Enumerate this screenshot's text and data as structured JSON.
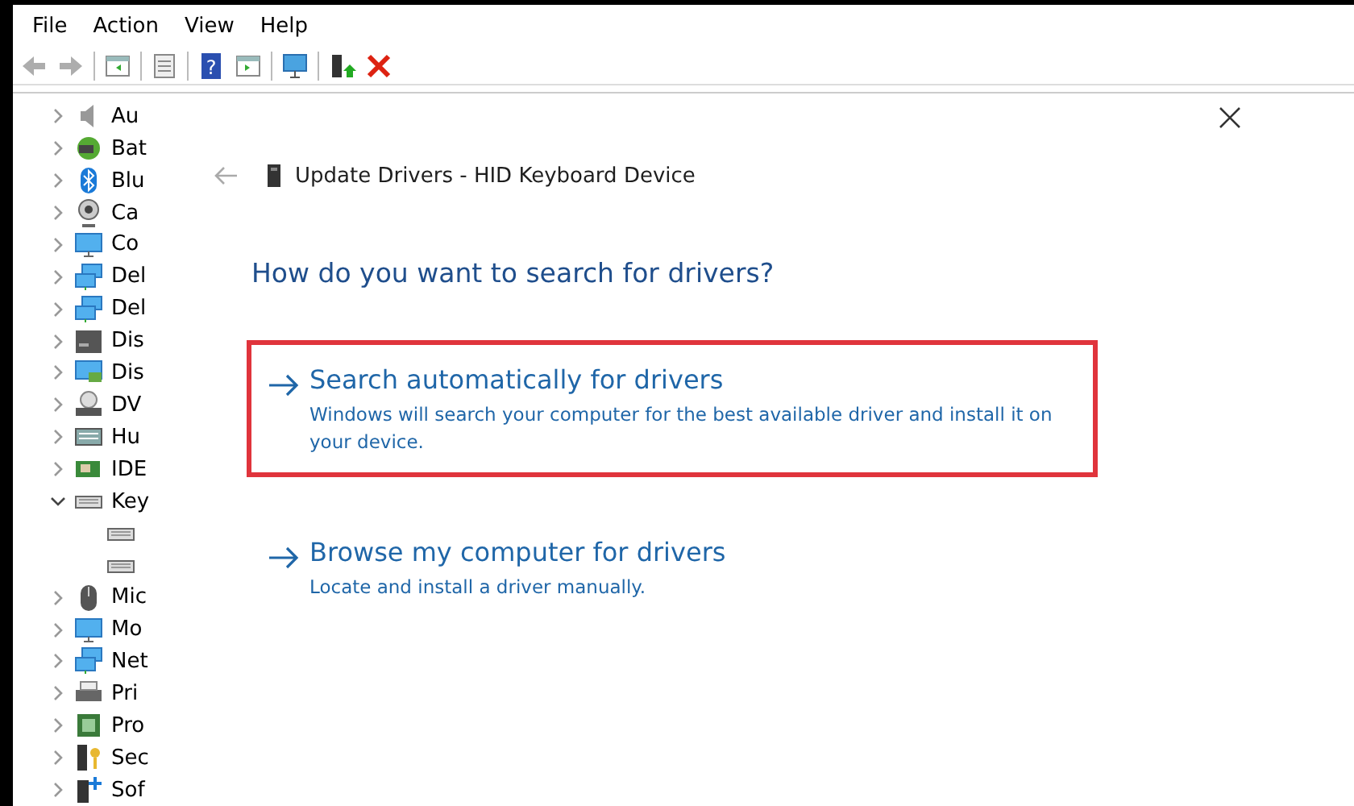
{
  "menu": [
    {
      "label": "File"
    },
    {
      "label": "Action"
    },
    {
      "label": "View"
    },
    {
      "label": "Help"
    }
  ],
  "toolbar": [
    {
      "kind": "back",
      "disabled": true
    },
    {
      "kind": "forward",
      "disabled": true
    },
    {
      "kind": "sep"
    },
    {
      "kind": "pane"
    },
    {
      "kind": "sep"
    },
    {
      "kind": "props"
    },
    {
      "kind": "sep"
    },
    {
      "kind": "help",
      "label": "?"
    },
    {
      "kind": "pane2"
    },
    {
      "kind": "sep"
    },
    {
      "kind": "scan"
    },
    {
      "kind": "sep"
    },
    {
      "kind": "update"
    },
    {
      "kind": "remove"
    }
  ],
  "tree": [
    {
      "label": "Au",
      "kind": "speaker",
      "expanded": false
    },
    {
      "label": "Bat",
      "kind": "battery",
      "expanded": false
    },
    {
      "label": "Blu",
      "kind": "bluetooth",
      "expanded": false
    },
    {
      "label": "Ca",
      "kind": "camera",
      "expanded": false
    },
    {
      "label": "Co",
      "kind": "monitor",
      "expanded": false
    },
    {
      "label": "Del",
      "kind": "network",
      "expanded": false
    },
    {
      "label": "Del",
      "kind": "network",
      "expanded": false
    },
    {
      "label": "Dis",
      "kind": "drive",
      "expanded": false
    },
    {
      "label": "Dis",
      "kind": "display",
      "expanded": false
    },
    {
      "label": "DV",
      "kind": "dvd",
      "expanded": false
    },
    {
      "label": "Hu",
      "kind": "hid",
      "expanded": false
    },
    {
      "label": "IDE",
      "kind": "card",
      "expanded": false
    },
    {
      "label": "Key",
      "kind": "keyboard",
      "expanded": true,
      "children": [
        {
          "kind": "keyboard"
        },
        {
          "kind": "keyboard"
        }
      ]
    },
    {
      "label": "Mic",
      "kind": "mouse",
      "expanded": false
    },
    {
      "label": "Mo",
      "kind": "monitor",
      "expanded": false
    },
    {
      "label": "Net",
      "kind": "network",
      "expanded": false
    },
    {
      "label": "Pri",
      "kind": "printer",
      "expanded": false
    },
    {
      "label": "Pro",
      "kind": "chip",
      "expanded": false
    },
    {
      "label": "Sec",
      "kind": "security",
      "expanded": false
    },
    {
      "label": "Sof",
      "kind": "software",
      "expanded": false
    }
  ],
  "dialog": {
    "title": "Update Drivers - HID Keyboard Device",
    "heading": "How do you want to search for drivers?",
    "options": [
      {
        "title": "Search automatically for drivers",
        "description": "Windows will search your computer for the best available driver and install it on your device.",
        "highlighted": true
      },
      {
        "title": "Browse my computer for drivers",
        "description": "Locate and install a driver manually.",
        "highlighted": false
      }
    ]
  }
}
